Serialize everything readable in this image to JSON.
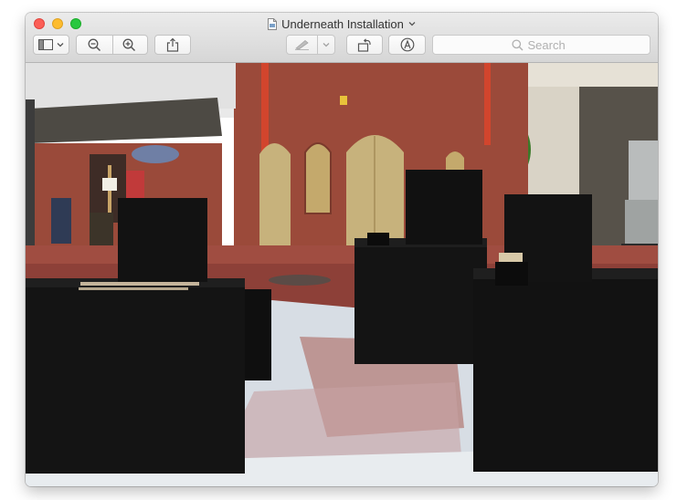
{
  "window": {
    "title": "Underneath Installation"
  },
  "toolbar": {
    "sidebar_icon": "sidebar-icon",
    "zoom_out_icon": "zoom-out-icon",
    "zoom_in_icon": "zoom-in-icon",
    "share_icon": "share-icon",
    "markup_icon": "pen-markup-icon",
    "rotate_icon": "rotate-icon",
    "annotate_icon": "annotate-icon"
  },
  "search": {
    "placeholder": "Search"
  },
  "image": {
    "description_icon": "photo",
    "colors": {
      "brick": "#9a4a3a",
      "boxes": "#121212",
      "door": "#c7b27c",
      "wall_right": "#d8d2c4"
    }
  }
}
